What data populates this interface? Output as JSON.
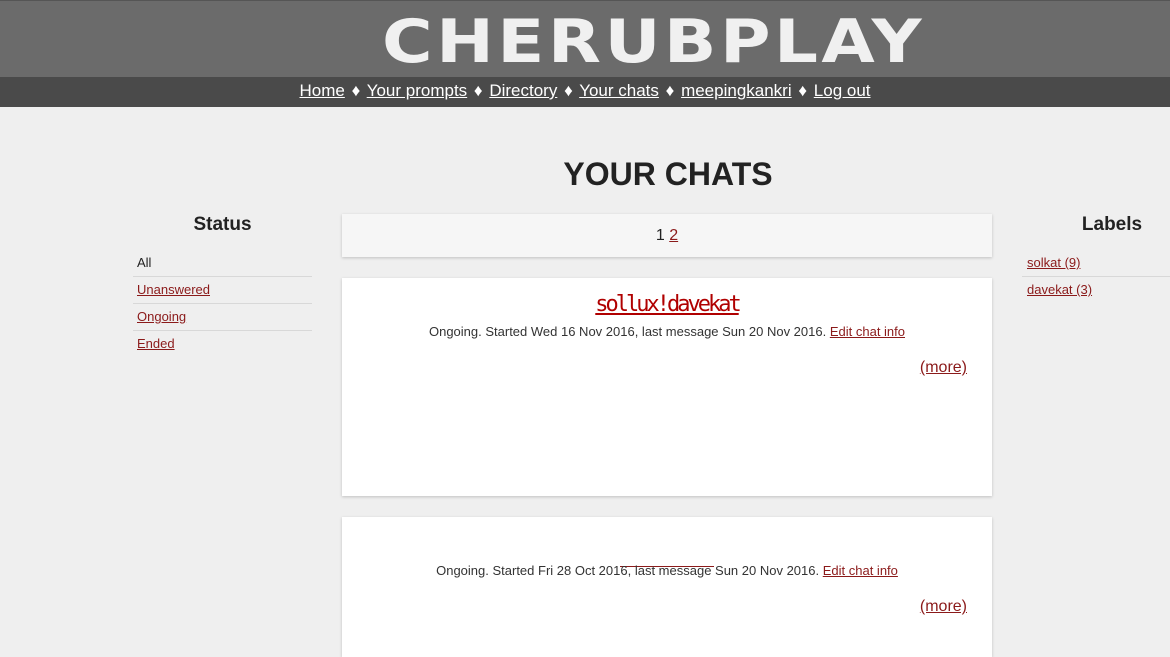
{
  "site": {
    "logo_text": "CHERUBPLAY"
  },
  "nav": {
    "items": [
      {
        "label": "Home"
      },
      {
        "label": "Your prompts"
      },
      {
        "label": "Directory"
      },
      {
        "label": "Your chats"
      },
      {
        "label": "meepingkankri"
      },
      {
        "label": "Log out"
      }
    ],
    "separator": "♦"
  },
  "page": {
    "title": "YOUR CHATS"
  },
  "status": {
    "heading": "Status",
    "items": [
      {
        "label": "All",
        "active": true
      },
      {
        "label": "Unanswered",
        "active": false
      },
      {
        "label": "Ongoing",
        "active": false
      },
      {
        "label": "Ended",
        "active": false
      }
    ]
  },
  "labels": {
    "heading": "Labels",
    "items": [
      {
        "label": "solkat (9)"
      },
      {
        "label": "davekat (3)"
      }
    ]
  },
  "pager": {
    "current": "1",
    "next": "2"
  },
  "chats": [
    {
      "title": "sollux!davekat",
      "info_text": "Ongoing. Started Wed 16 Nov 2016, last message Sun 20 Nov 2016.",
      "edit_label": "Edit chat info",
      "more_label": "(more)"
    },
    {
      "title": "",
      "info_text": "Ongoing. Started Fri 28 Oct 2016, last message Sun 20 Nov 2016.",
      "edit_label": "Edit chat info",
      "more_label": "(more)"
    }
  ],
  "colors": {
    "header_bg": "#6b6b6b",
    "navbar_bg": "#4a4a4a",
    "page_bg": "#efefef",
    "link": "#8b1a1a"
  }
}
